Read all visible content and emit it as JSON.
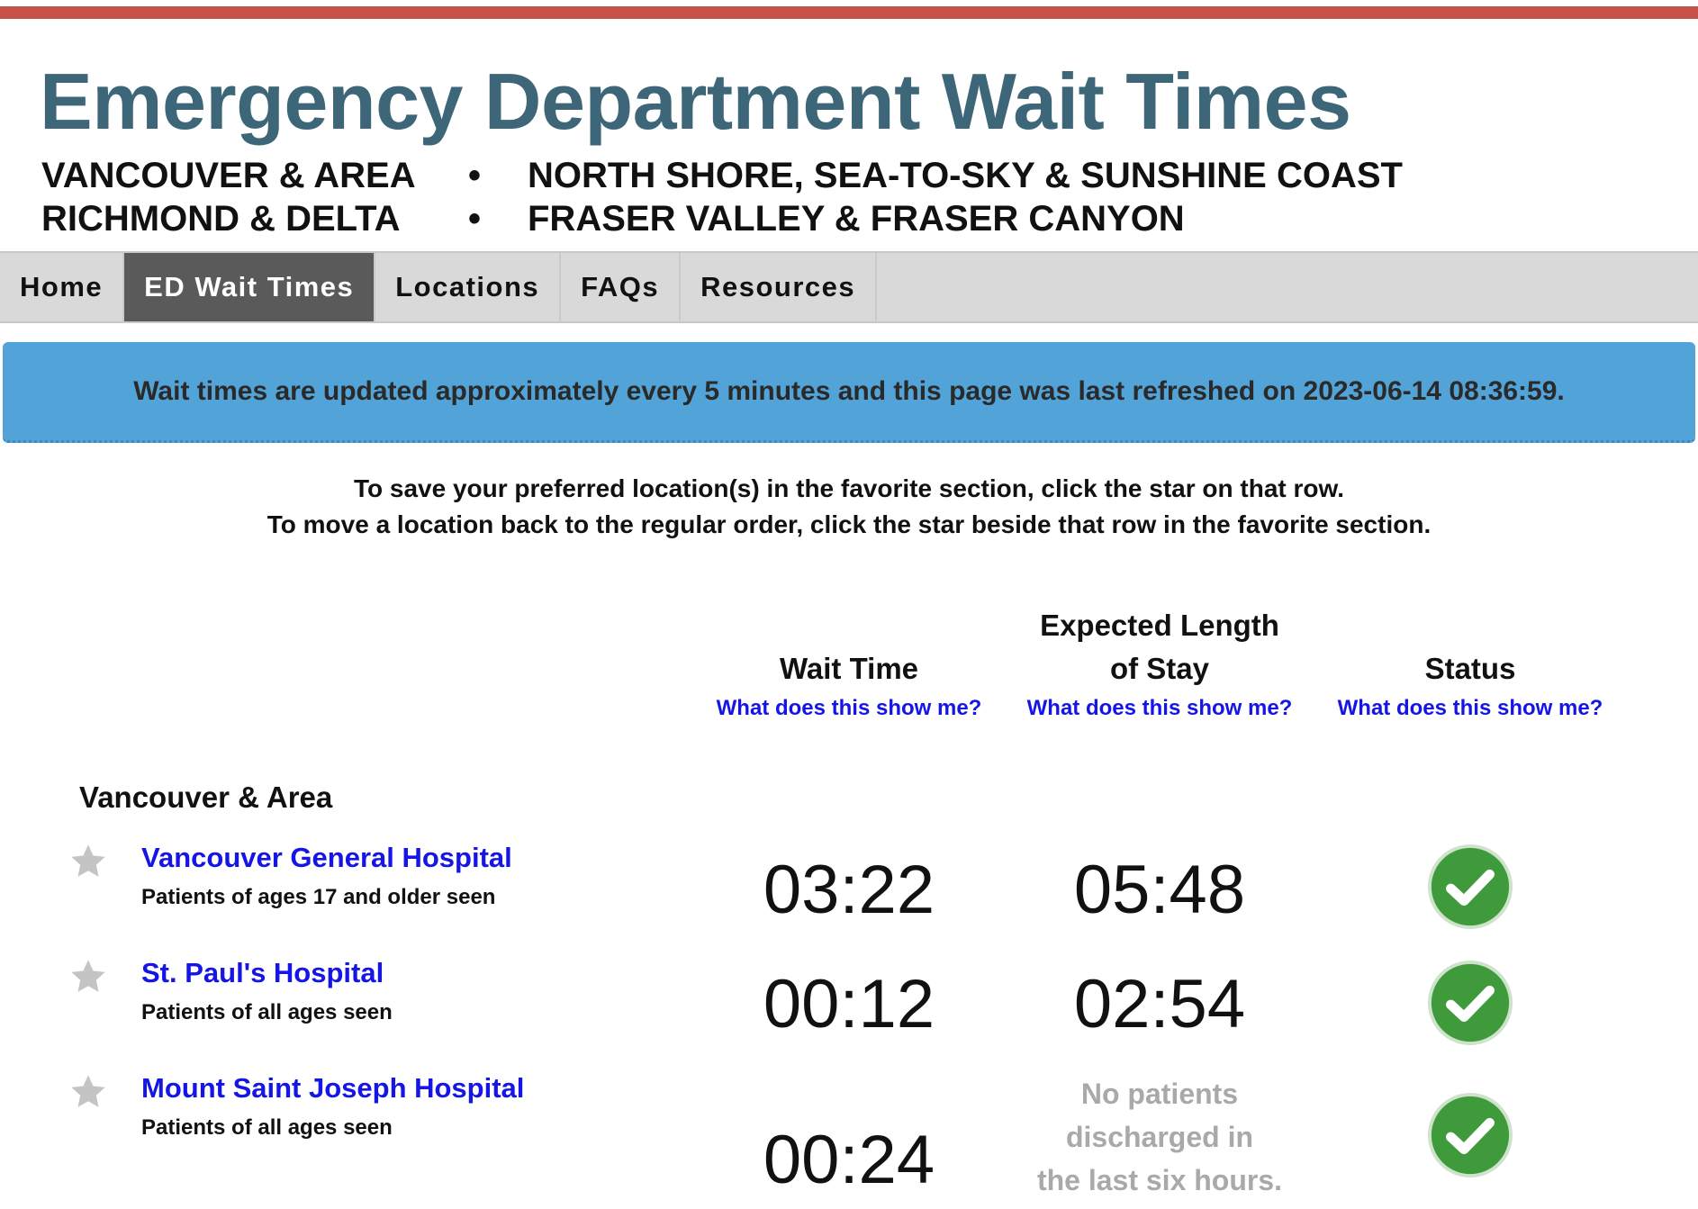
{
  "header": {
    "title": "Emergency Department Wait Times",
    "regions": [
      "VANCOUVER & AREA",
      "RICHMOND & DELTA",
      "NORTH SHORE, SEA-TO-SKY & SUNSHINE COAST",
      "FRASER VALLEY & FRASER CANYON"
    ],
    "bullet": "•",
    "accent_color": "#c8504a",
    "title_color": "#3d6678"
  },
  "nav": {
    "items": [
      {
        "label": "Home",
        "active": false
      },
      {
        "label": "ED Wait Times",
        "active": true
      },
      {
        "label": "Locations",
        "active": false
      },
      {
        "label": "FAQs",
        "active": false
      },
      {
        "label": "Resources",
        "active": false
      }
    ]
  },
  "banner": {
    "text": "Wait times are updated approximately every 5 minutes and this page was last refreshed on 2023-06-14 08:36:59.",
    "color": "#52a3d8"
  },
  "instructions": [
    "To save your preferred location(s) in the favorite section, click the star on that row.",
    "To move a location back to the regular order, click the star beside that row in the favorite section."
  ],
  "columns": {
    "wait": {
      "title": "Wait Time",
      "help": "What does this show me?"
    },
    "stay": {
      "title_line1": "Expected Length",
      "title_line2": "of Stay",
      "help": "What does this show me?"
    },
    "status": {
      "title": "Status",
      "help": "What does this show me?"
    }
  },
  "section": {
    "title": "Vancouver & Area",
    "hospitals": [
      {
        "name": "Vancouver General Hospital",
        "note": "Patients of ages 17 and older seen",
        "wait": "03:22",
        "stay": "05:48",
        "status": "check-icon"
      },
      {
        "name": "St. Paul's Hospital",
        "note": "Patients of all ages seen",
        "wait": "00:12",
        "stay": "02:54",
        "status": "check-icon"
      },
      {
        "name": "Mount Saint Joseph Hospital",
        "note": "Patients of all ages seen",
        "wait": "00:24",
        "stay_message": [
          "No patients",
          "discharged in",
          "the last six hours."
        ],
        "status": "check-icon"
      }
    ]
  },
  "icons": {
    "star": "star-icon",
    "status_color": "#3f9a3c"
  }
}
